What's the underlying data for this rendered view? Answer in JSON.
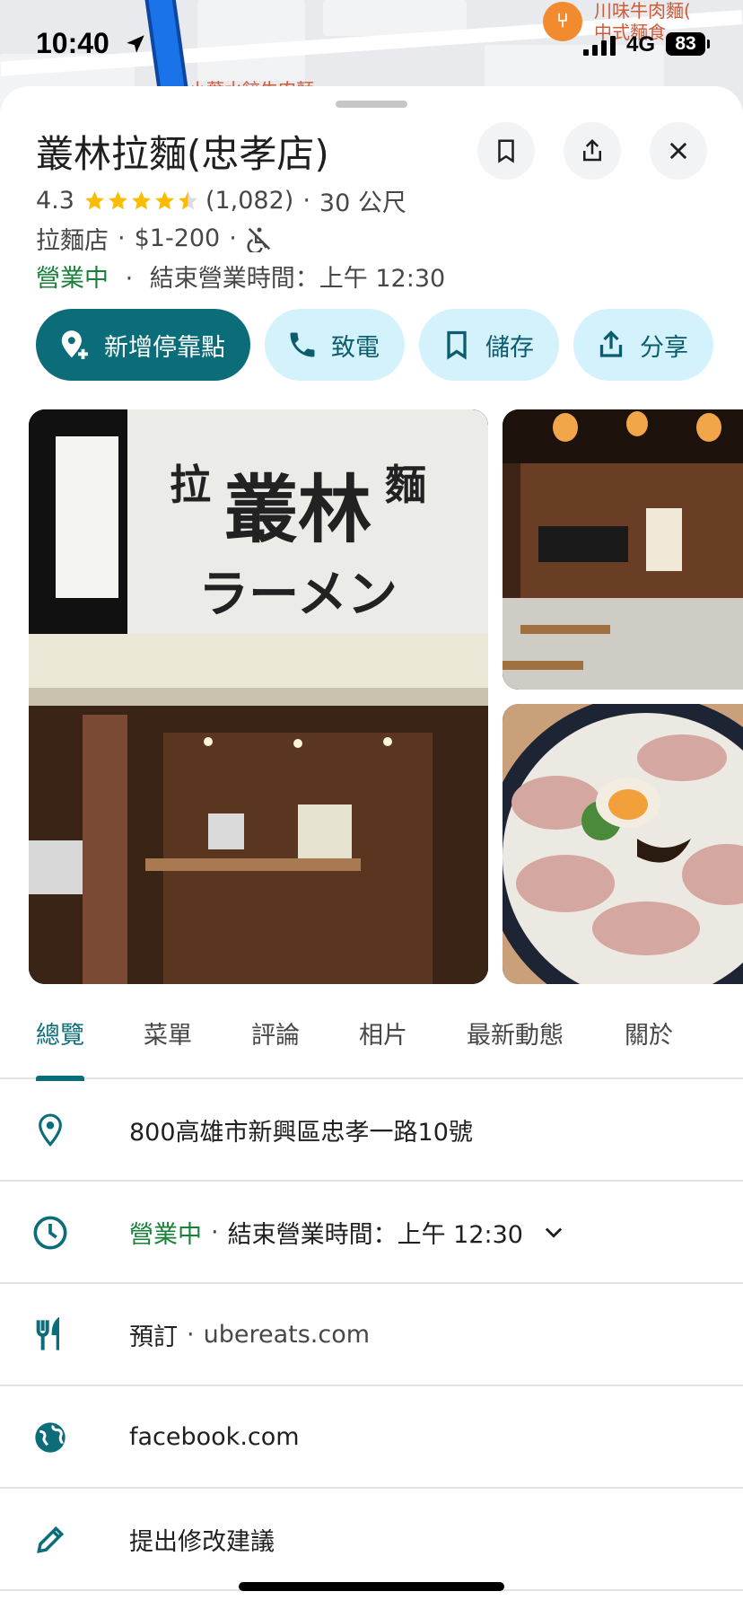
{
  "status_bar": {
    "time": "10:40",
    "network": "4G",
    "battery": "83"
  },
  "map": {
    "poi_label_1": "川味牛肉麵(",
    "poi_label_2": "中式麵食",
    "street_label": "小葉水餃牛肉麵"
  },
  "place": {
    "name": "叢林拉麵(忠孝店)",
    "rating": "4.3",
    "rating_stars": 4.5,
    "review_count": "(1,082)",
    "distance": "30 公尺",
    "category": "拉麵店",
    "price": "$1-200",
    "accessibility_icon": "no-wheelchair-icon",
    "open_status": "營業中",
    "closing_text": "結束營業時間：上午 12:30"
  },
  "actions": [
    {
      "label": "新增停靠點",
      "icon": "add-stop-pin-icon"
    },
    {
      "label": "致電",
      "icon": "phone-icon"
    },
    {
      "label": "儲存",
      "icon": "bookmark-icon"
    },
    {
      "label": "分享",
      "icon": "share-icon"
    }
  ],
  "photos": {
    "main_sign_line1": "叢林",
    "main_sign_line2": "ラーメン",
    "main_sign_left": "拉",
    "main_sign_right": "麵"
  },
  "tabs": [
    "總覽",
    "菜單",
    "評論",
    "相片",
    "最新動態",
    "關於"
  ],
  "active_tab": 0,
  "details": {
    "address": "800高雄市新興區忠孝一路10號",
    "hours_status": "營業中",
    "hours_text": "結束營業時間：上午 12:30",
    "order_label": "預訂",
    "order_site": "ubereats.com",
    "website": "facebook.com",
    "suggest_edit": "提出修改建議"
  },
  "colors": {
    "accent": "#0b6d7a",
    "chip_bg": "#d3f2fb",
    "open_green": "#188038",
    "star": "#fbbc04"
  }
}
